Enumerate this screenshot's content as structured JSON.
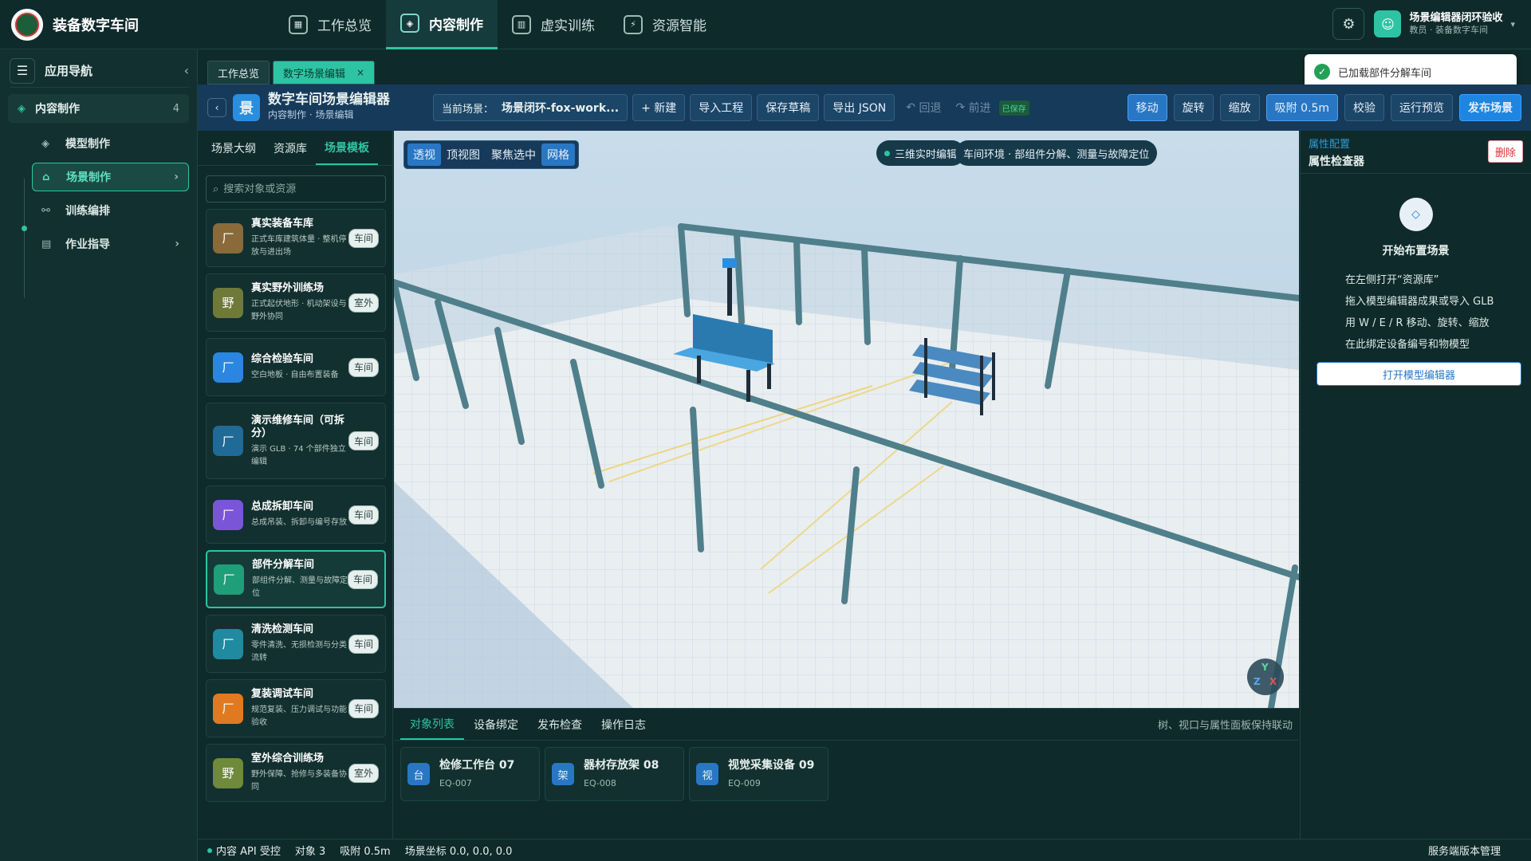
{
  "app": {
    "title": "装备数字车间"
  },
  "topnav": [
    {
      "label": "工作总览",
      "icon": "grid-icon"
    },
    {
      "label": "内容制作",
      "icon": "cube-icon",
      "active": true
    },
    {
      "label": "虚实训练",
      "icon": "book-icon"
    },
    {
      "label": "资源智能",
      "icon": "plug-icon"
    }
  ],
  "user": {
    "name": "场景编辑器闭环验收",
    "role": "教员 · 装备数字车间"
  },
  "sidebar": {
    "header": "应用导航",
    "section": {
      "label": "内容制作",
      "count": "4"
    },
    "items": [
      {
        "label": "模型制作"
      },
      {
        "label": "场景制作"
      },
      {
        "label": "训练编排"
      },
      {
        "label": "作业指导"
      }
    ]
  },
  "tabs": [
    {
      "label": "工作总览"
    },
    {
      "label": "数字场景编辑",
      "close": "×"
    }
  ],
  "toast": {
    "text": "已加载部件分解车间"
  },
  "editor": {
    "icon_text": "景",
    "title": "数字车间场景编辑器",
    "breadcrumb": "内容制作 · 场景编辑",
    "scene_label": "当前场景：",
    "scene_value": "场景闭环-fox-work...",
    "new_btn": "+ 新建",
    "import_btn": "导入工程",
    "save_btn": "保存草稿",
    "export_btn": "导出 JSON",
    "undo": "回退",
    "redo": "前进",
    "saved": "已保存",
    "tools": {
      "move": "移动",
      "rotate": "旋转",
      "scale": "缩放",
      "snap": "吸附 0.5m",
      "check": "校验",
      "preview": "运行预览",
      "publish": "发布场景"
    }
  },
  "leftpanel": {
    "tabs": [
      "场景大纲",
      "资源库",
      "场景模板"
    ],
    "search_placeholder": "搜索对象或资源",
    "cards": [
      {
        "icon": "厂",
        "color": "#8a6a3a",
        "title": "真实装备车库",
        "desc": "正式车库建筑体量 · 整机停放与进出场",
        "tag": "车间"
      },
      {
        "icon": "野",
        "color": "#6f7a3a",
        "title": "真实野外训练场",
        "desc": "正式起伏地形 · 机动架设与野外协同",
        "tag": "室外"
      },
      {
        "icon": "厂",
        "color": "#2a86e0",
        "title": "综合检验车间",
        "desc": "空白地板 · 自由布置装备",
        "tag": "车间"
      },
      {
        "icon": "厂",
        "color": "#1f6a96",
        "title": "演示维修车间（可拆分）",
        "desc": "演示 GLB · 74 个部件独立编辑",
        "tag": "车间"
      },
      {
        "icon": "厂",
        "color": "#7a55d8",
        "title": "总成拆卸车间",
        "desc": "总成吊装、拆卸与编号存放",
        "tag": "车间"
      },
      {
        "icon": "厂",
        "color": "#1f9e7a",
        "title": "部件分解车间",
        "desc": "部组件分解、测量与故障定位",
        "tag": "车间"
      },
      {
        "icon": "厂",
        "color": "#1f8aa0",
        "title": "清洗检测车间",
        "desc": "零件清洗、无损检测与分类流转",
        "tag": "车间"
      },
      {
        "icon": "厂",
        "color": "#e07a20",
        "title": "复装调试车间",
        "desc": "规范复装、压力调试与功能验收",
        "tag": "车间"
      },
      {
        "icon": "野",
        "color": "#6f8a3a",
        "title": "室外综合训练场",
        "desc": "野外保障、抢修与多装备协同",
        "tag": "室外"
      }
    ]
  },
  "viewport": {
    "view_buttons": [
      "透视",
      "顶视图",
      "聚焦选中",
      "网格"
    ],
    "mode_pill": "三维实时编辑",
    "env_pill": "车间环境 · 部组件分解、测量与故障定位",
    "axis": {
      "y": "Y",
      "z": "Z",
      "x": "X"
    }
  },
  "bottom": {
    "tabs": [
      "对象列表",
      "设备绑定",
      "发布检查",
      "操作日志"
    ],
    "note": "树、视口与属性面板保持联动",
    "objects": [
      {
        "icon": "台",
        "name": "检修工作台 07",
        "code": "EQ-007"
      },
      {
        "icon": "架",
        "name": "器材存放架 08",
        "code": "EQ-008"
      },
      {
        "icon": "视",
        "name": "视觉采集设备 09",
        "code": "EQ-009"
      }
    ]
  },
  "inspector": {
    "subtitle": "属性配置",
    "title": "属性检查器",
    "delete": "删除",
    "start_icon": "◇",
    "start_title": "开始布置场景",
    "steps": [
      "在左侧打开“资源库”",
      "拖入模型编辑器成果或导入 GLB",
      "用 W / E / R 移动、旋转、缩放",
      "在此绑定设备编号和物模型"
    ],
    "open_btn": "打开模型编辑器"
  },
  "status": {
    "api": "内容 API 受控",
    "objects": "对象 3",
    "snap": "吸附 0.5m",
    "coords": "场景坐标 0.0, 0.0, 0.0",
    "right": "服务端版本管理"
  }
}
